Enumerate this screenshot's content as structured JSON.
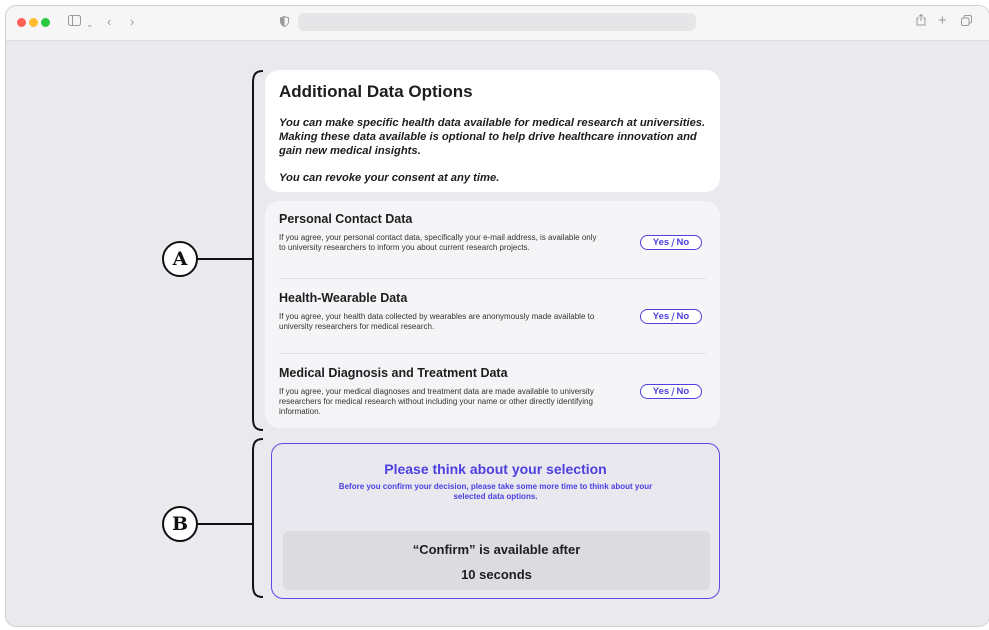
{
  "intro": {
    "title": "Additional Data Options",
    "paragraph": "You can make specific health data available for medical research at universities. Making these data available is optional to help drive healthcare innovation and gain new medical insights.",
    "revoke": "You can revoke your consent at any time."
  },
  "options": [
    {
      "title": "Personal Contact Data",
      "description": "If you agree, your personal contact data, specifically your e-mail address, is available only to university researchers to inform you about current research projects.",
      "yes_label": "Yes",
      "no_label": "No"
    },
    {
      "title": "Health-Wearable Data",
      "description": "If you agree, your health data collected by wearables are anonymously made available to university researchers for medical research.",
      "yes_label": "Yes",
      "no_label": "No"
    },
    {
      "title": "Medical Diagnosis and Treatment Data",
      "description": "If you agree, your medical diagnoses and treatment data are made available to university researchers for medical research without including your name or other directly identifying information.",
      "yes_label": "Yes",
      "no_label": "No"
    }
  ],
  "reflection": {
    "title": "Please think about your selection",
    "note": "Before you confirm your decision, please take some more time to think about your selected data options.",
    "confirm_line1": "“Confirm” is available after",
    "confirm_line2": "10 seconds"
  },
  "annotations": {
    "a": "A",
    "b": "B"
  },
  "colors": {
    "accent": "#4d3fe0",
    "card": "#ffffff",
    "background": "#e9e9ee"
  },
  "icons": [
    "sidebar-icon",
    "chevron-down-icon",
    "back-icon",
    "forward-icon",
    "shield-icon",
    "share-icon",
    "plus-icon",
    "tabs-icon"
  ]
}
